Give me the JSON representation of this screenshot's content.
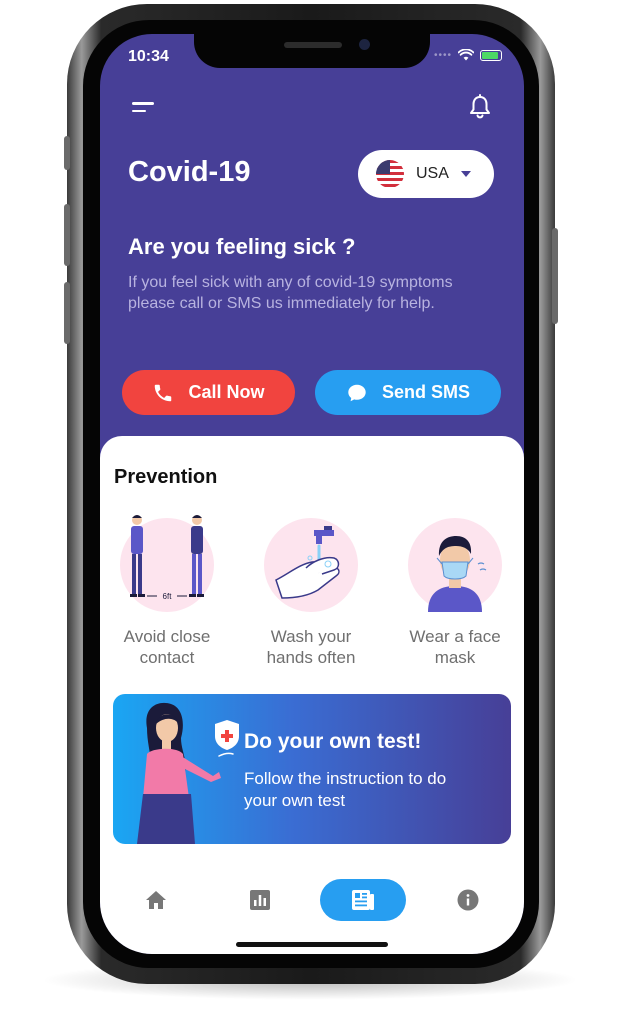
{
  "status_bar": {
    "time": "10:34",
    "dots": "••••"
  },
  "header": {
    "title": "Covid-19"
  },
  "country_picker": {
    "label": "USA"
  },
  "sick": {
    "title": "Are you feeling sick ?",
    "text": "If you feel sick with any of covid-19 symptoms please call or SMS us immediately for help."
  },
  "actions": {
    "call_label": "Call Now",
    "sms_label": "Send SMS"
  },
  "prevention": {
    "title": "Prevention",
    "items": [
      {
        "label": "Avoid close contact",
        "sublabel": "6ft"
      },
      {
        "label": "Wash your hands often"
      },
      {
        "label": "Wear a face mask"
      }
    ]
  },
  "banner": {
    "title": "Do your own test!",
    "text": "Follow the instruction to do your own test"
  },
  "tabs": [
    {
      "icon": "home-icon"
    },
    {
      "icon": "chart-icon"
    },
    {
      "icon": "news-icon",
      "active": true
    },
    {
      "icon": "info-icon"
    }
  ],
  "colors": {
    "header_bg": "#473f97",
    "call_red": "#f1443f",
    "sms_blue": "#279ef1",
    "circle_pink": "#fde4ee"
  }
}
